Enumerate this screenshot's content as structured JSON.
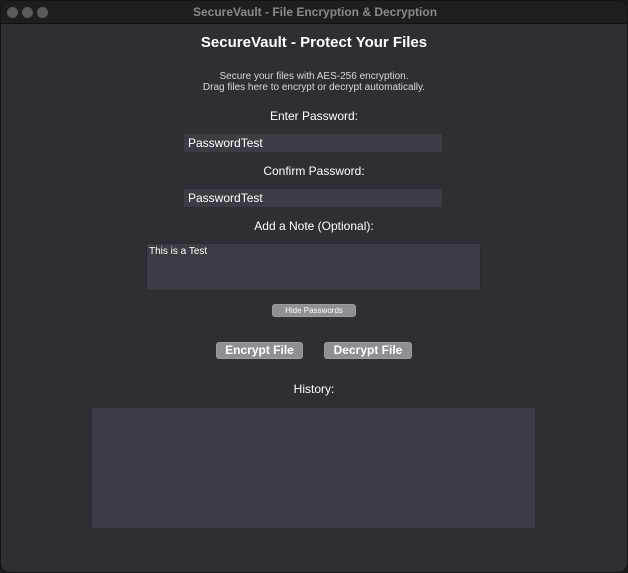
{
  "window": {
    "title": "SecureVault - File Encryption & Decryption"
  },
  "main": {
    "heading": "SecureVault - Protect Your Files",
    "description_line1": "Secure your files with AES-256 encryption.",
    "description_line2": "Drag files here to encrypt or decrypt automatically.",
    "password_label": "Enter Password:",
    "password_value": "PasswordTest",
    "confirm_label": "Confirm Password:",
    "confirm_value": "PasswordTest",
    "note_label": "Add a Note (Optional):",
    "note_value": "This is a Test",
    "hide_passwords_label": "Hide Passwords",
    "encrypt_label": "Encrypt File",
    "decrypt_label": "Decrypt File",
    "history_label": "History:"
  }
}
